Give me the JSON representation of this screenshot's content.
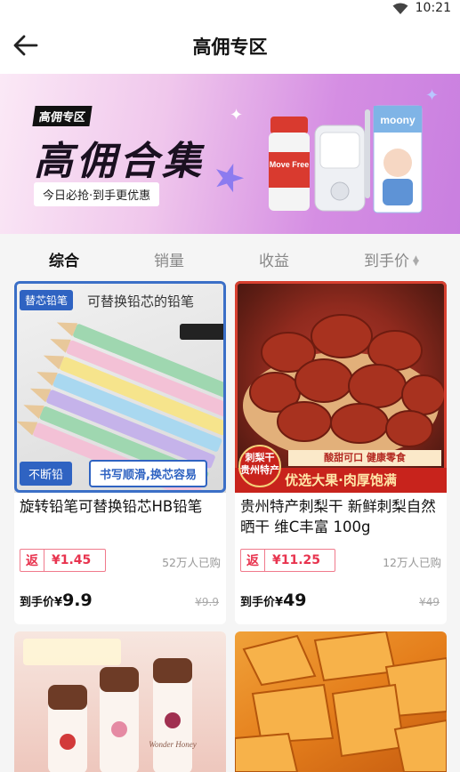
{
  "status_bar": {
    "time": "10:21"
  },
  "nav": {
    "title": "高佣专区"
  },
  "banner": {
    "tag": "高佣专区",
    "headline": "高佣合集",
    "subtitle": "今日必抢·到手更优惠",
    "bottle_brand": "Move Free",
    "diaper_brand": "moony"
  },
  "tabs": [
    {
      "label": "综合",
      "active": true
    },
    {
      "label": "销量",
      "active": false
    },
    {
      "label": "收益",
      "active": false
    },
    {
      "label": "到手价",
      "active": false
    }
  ],
  "products": [
    {
      "image_tag": "替芯铅笔",
      "image_title": "可替换铅芯的铅笔",
      "image_badge_left": "不断铅",
      "image_badge_right": "书写顺滑,换芯容易",
      "name": "旋转铅笔可替换铅芯HB铅笔",
      "rebate_label": "返",
      "rebate_amount": "¥1.45",
      "sold": "52万人已购",
      "final_label": "到手价",
      "final_currency": "¥",
      "final_price": "9.9",
      "original_price": "¥9.9"
    },
    {
      "image_seal": "刺梨干 贵州特产",
      "image_sub": "酸甜可口  健康零食",
      "image_banner": "优选大果·肉厚饱满",
      "name": "贵州特产刺梨干 新鲜刺梨自然晒干 维C丰富 100g",
      "rebate_label": "返",
      "rebate_amount": "¥11.25",
      "sold": "12万人已购",
      "final_label": "到手价",
      "final_currency": "¥",
      "final_price": "49",
      "original_price": "¥49"
    }
  ],
  "product3": {
    "image_text": "Wonder Honey"
  }
}
